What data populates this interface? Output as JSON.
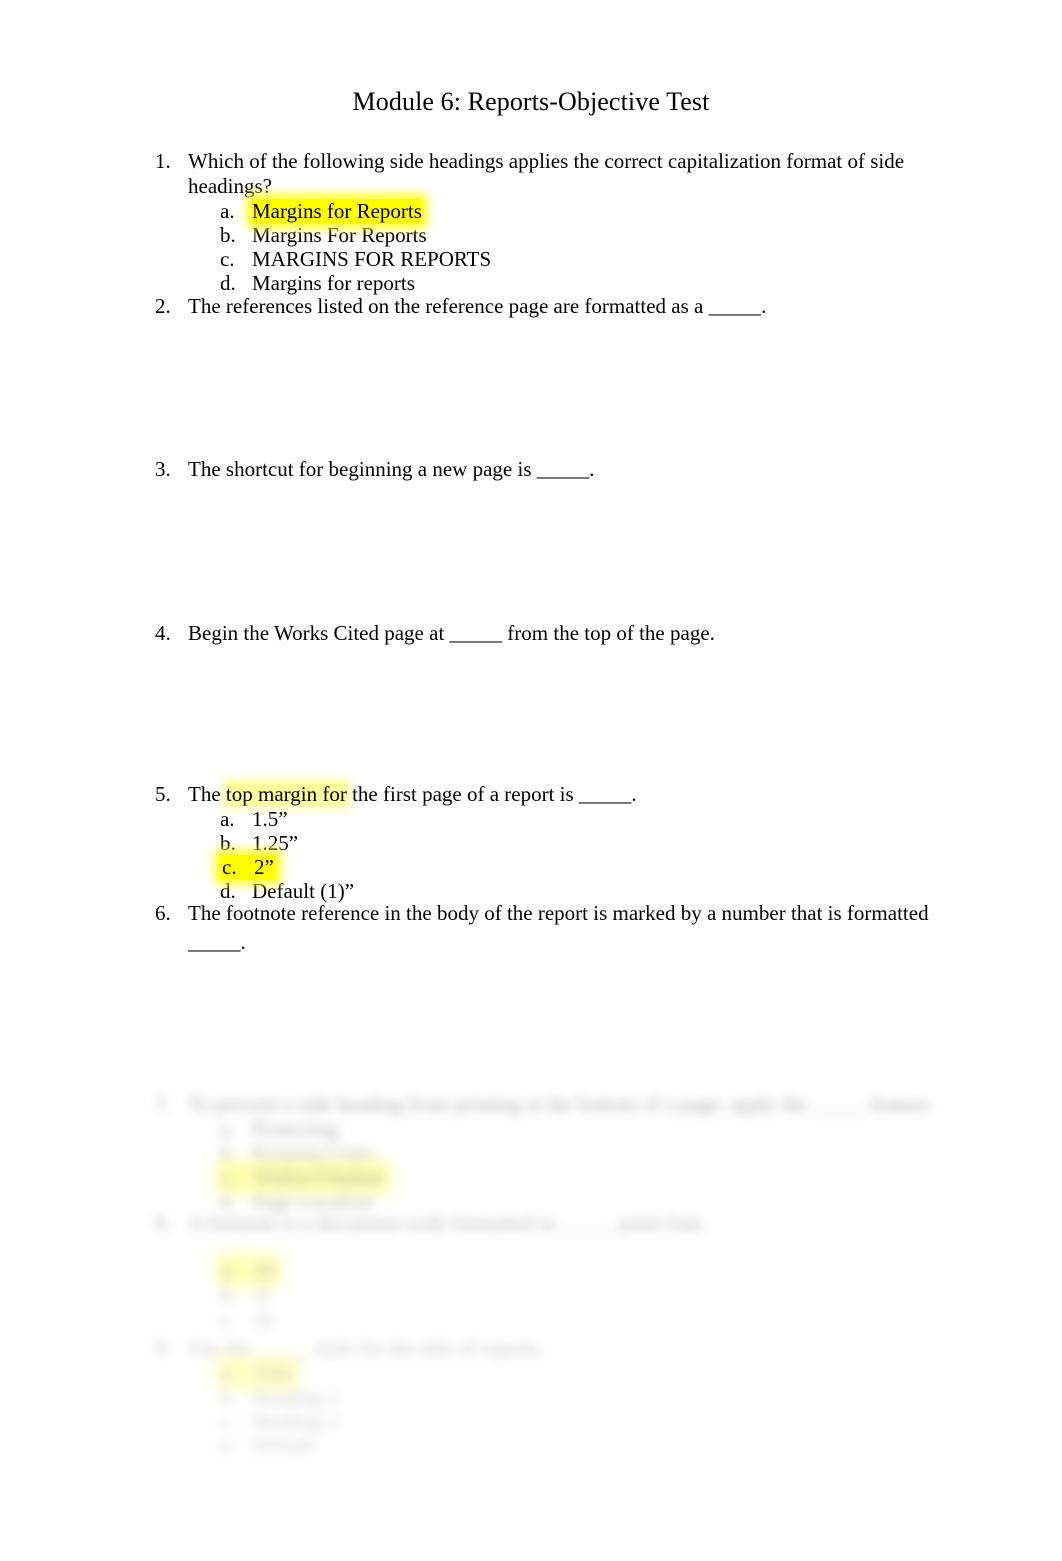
{
  "document": {
    "title": "Module 6: Reports-Objective Test",
    "highlight_color": "#ffff00",
    "page_background": "#ffffff",
    "text_color": "#000000"
  },
  "questions": [
    {
      "number": "1.",
      "text": "Which of the following side headings applies the correct capitalization format of side headings?",
      "options": [
        {
          "letter": "a.",
          "text": "Margins for Reports",
          "highlighted": true
        },
        {
          "letter": "b.",
          "text": "Margins For Reports",
          "highlighted": false
        },
        {
          "letter": "c.",
          "text": "MARGINS FOR REPORTS",
          "highlighted": false
        },
        {
          "letter": "d.",
          "text": "Margins for reports",
          "highlighted": false
        }
      ]
    },
    {
      "number": "2.",
      "text": "The references listed on the reference page are formatted as a _____.",
      "options": []
    },
    {
      "number": "3.",
      "text": "The shortcut for beginning a new page is _____.",
      "options": []
    },
    {
      "number": "4.",
      "text": "Begin the Works Cited page at _____ from the top of the page.",
      "options": []
    },
    {
      "number": "5.",
      "text_before": "The ",
      "text_highlight": "top margin for",
      "text_after": " the first page of a report is _____.",
      "options": [
        {
          "letter": "a.",
          "text": "1.5”",
          "highlighted": false
        },
        {
          "letter": "b.",
          "text": "1.25”",
          "highlighted": false
        },
        {
          "letter": "c.",
          "text": "2”",
          "highlighted": true
        },
        {
          "letter": "d.",
          "text": "Default (1)”",
          "highlighted": false
        }
      ]
    },
    {
      "number": "6.",
      "text": "The footnote reference in the body of the report is marked by a number that is formatted",
      "text_line2": "_____.",
      "options": []
    }
  ],
  "obscured_questions": [
    {
      "number": "7.",
      "text": "To prevent a side heading from printing at the bottom of a page, apply the _____ feature.",
      "options": [
        {
          "letter": "a.",
          "text": "Protecting",
          "highlighted": false
        },
        {
          "letter": "b.",
          "text": "Keeping Lines",
          "highlighted": false
        },
        {
          "letter": "c.",
          "text": "Widow/Orphan",
          "highlighted": true
        },
        {
          "letter": "d.",
          "text": "Page Location",
          "highlighted": false
        }
      ]
    },
    {
      "number": "8.",
      "text": "A footnote is a document-wide formatted in _____ point font.",
      "options": [
        {
          "letter": "a.",
          "text": "10",
          "highlighted": true
        },
        {
          "letter": "b.",
          "text": "11",
          "highlighted": false
        },
        {
          "letter": "c.",
          "text": "12",
          "highlighted": false
        }
      ]
    },
    {
      "number": "9.",
      "text": "Use the _____ style for the title of reports.",
      "options": [
        {
          "letter": "a.",
          "text": "Title",
          "highlighted": true
        },
        {
          "letter": "b.",
          "text": "Heading 1",
          "highlighted": false
        },
        {
          "letter": "c.",
          "text": "Heading 2",
          "highlighted": false
        },
        {
          "letter": "d.",
          "text": "Default",
          "highlighted": false
        }
      ]
    }
  ]
}
